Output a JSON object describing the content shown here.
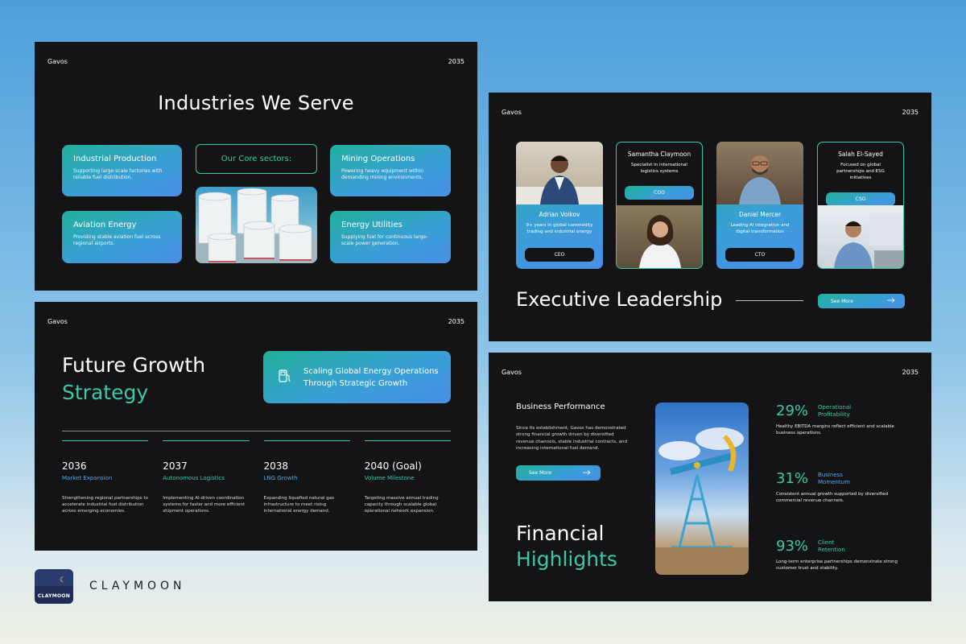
{
  "colors": {
    "accent_teal": "#38c9a9",
    "accent_blue": "#4fa8ea",
    "slide_bg": "#141416"
  },
  "slide1": {
    "brand": "Gavos",
    "year": "2035",
    "title": "Industries We Serve",
    "core_label": "Our Core sectors:",
    "cards": [
      {
        "title": "Industrial Production",
        "desc": "Supporting large-scale factories with reliable fuel distribution."
      },
      {
        "title": "Mining Operations",
        "desc": "Powering heavy equipment within demanding mining environments."
      },
      {
        "title": "Aviation Energy",
        "desc": "Providing stable aviation fuel across regional airports."
      },
      {
        "title": "Energy Utilities",
        "desc": "Supplying fuel for continuous large-scale power generation."
      }
    ]
  },
  "slide2": {
    "brand": "Gavos",
    "year": "2035",
    "title_line1": "Future Growth",
    "title_line2": "Strategy",
    "box_line1": "Scaling Global Energy Operations",
    "box_line2": "Through Strategic Growth",
    "milestones": [
      {
        "year": "2036",
        "label": "Market Expansion",
        "desc": "Strengthening regional partnerships to accelerate industrial fuel distribution across emerging economies."
      },
      {
        "year": "2037",
        "label": "Autonomous Logistics",
        "desc": "Implementing AI-driven coordination systems for faster and more efficient shipment operations."
      },
      {
        "year": "2038",
        "label": "LNG Growth",
        "desc": "Expanding liquefied natural gas infrastructure to meet rising international energy demand."
      },
      {
        "year": "2040 (Goal)",
        "label": "Volume Milestone",
        "desc": "Targeting massive annual trading capacity through scalable global operational network expansion."
      }
    ]
  },
  "slide3": {
    "brand": "Gavos",
    "year": "2035",
    "title": "Executive Leadership",
    "see_more": "See More",
    "execs": [
      {
        "name": "Adrian Volkov",
        "desc": "9+ years in global commodity trading and industrial energy",
        "role": "CEO"
      },
      {
        "name": "Samantha Claymoon",
        "desc": "Specialist in international logistics systems",
        "role": "COO"
      },
      {
        "name": "Daniel Mercer",
        "desc": "Leading AI integration and digital transformation",
        "role": "CTO"
      },
      {
        "name": "Salah El-Sayed",
        "desc": "Focused on global partnerships and ESG initiatives",
        "role": "CSO"
      }
    ]
  },
  "slide4": {
    "brand": "Gavos",
    "year": "2035",
    "bp_title": "Business Performance",
    "bp_desc": "Since its establishment, Gavos has demonstrated strong financial growth driven by diversified revenue channels, stable industrial contracts, and increasing international fuel demand.",
    "see_more": "See More",
    "title_line1": "Financial",
    "title_line2": "Highlights",
    "stats": [
      {
        "pct": "29%",
        "label1": "Operational",
        "label2": "Profitability",
        "desc": "Healthy EBITDA margins reflect efficient and scalable business operations."
      },
      {
        "pct": "31%",
        "label1": "Business",
        "label2": "Momentum",
        "desc": "Consistent annual growth supported by diversified commercial revenue channels."
      },
      {
        "pct": "93%",
        "label1": "Client",
        "label2": "Retention",
        "desc": "Long-term enterprise partnerships demonstrate strong customer trust and stability."
      }
    ]
  },
  "footer": {
    "logo_text": "CLAYMOON",
    "brand_name": "CLAYMOON"
  }
}
